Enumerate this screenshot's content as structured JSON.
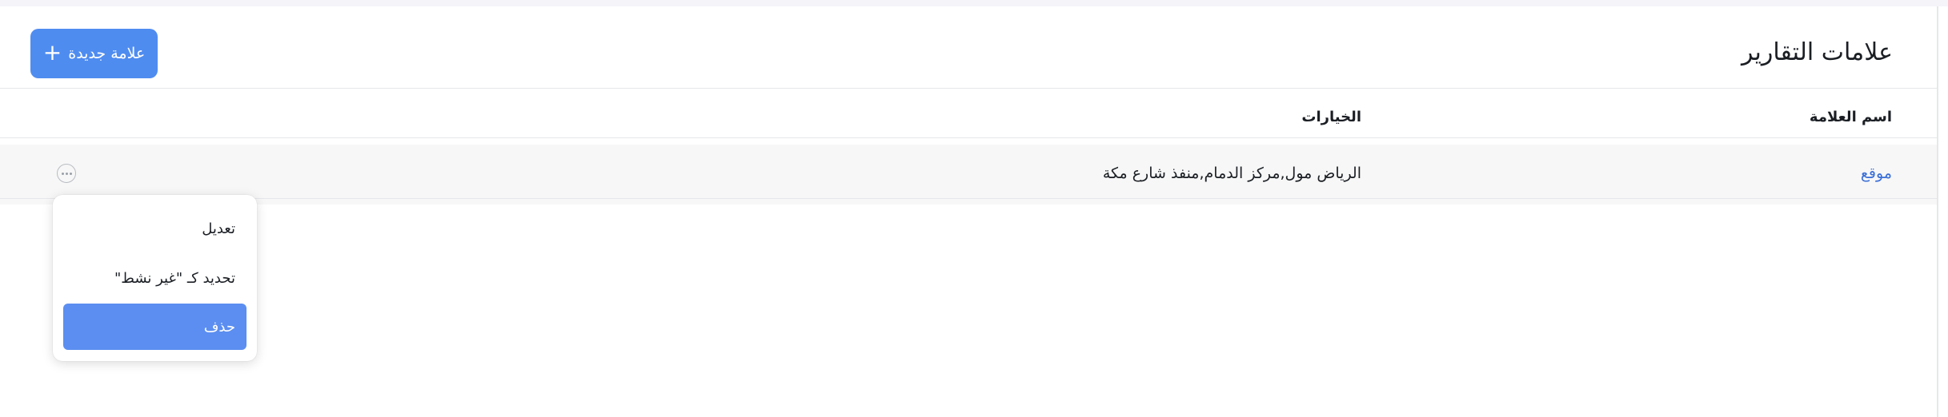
{
  "header": {
    "title": "علامات التقارير",
    "new_button_label": "علامة جديدة",
    "new_button_icon": "plus-icon"
  },
  "table": {
    "columns": [
      "اسم العلامة",
      "الخيارات"
    ],
    "rows": [
      {
        "name": "موقع",
        "options": "الرياض مول,مركز الدمام,منفذ شارع مكة"
      }
    ]
  },
  "menu": {
    "items": [
      "تعديل",
      "تحديد كـ \"غير نشط\"",
      "حذف"
    ]
  },
  "colors": {
    "accent": "#4f8cf0",
    "link": "#3a6fd8",
    "row_bg": "#f7f7f7"
  }
}
